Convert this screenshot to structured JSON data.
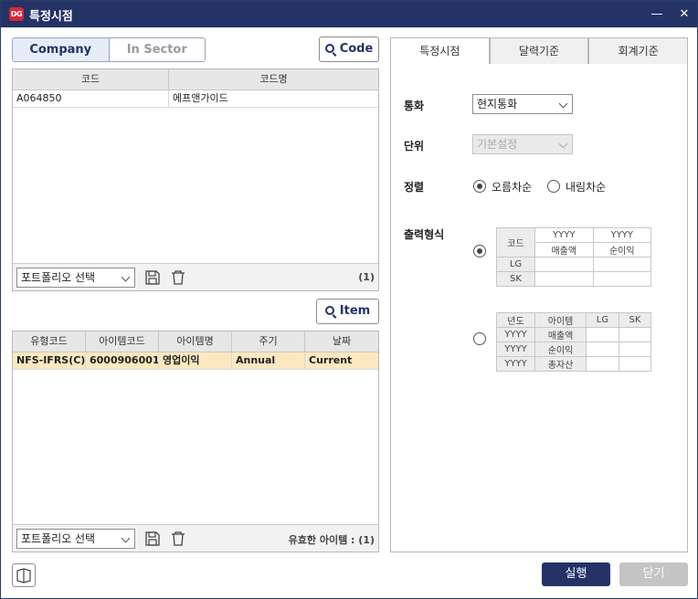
{
  "window": {
    "title": "특정시점",
    "icon_label": "DG"
  },
  "seg": {
    "company": "Company",
    "sector": "In Sector"
  },
  "buttons": {
    "code": "Code",
    "item": "Item",
    "run": "실행",
    "close": "닫기"
  },
  "company_grid": {
    "headers": [
      "코드",
      "코드명"
    ],
    "rows": [
      [
        "A064850",
        "에프앤가이드"
      ]
    ],
    "portfolio": "포트폴리오 선택",
    "count": "(1)"
  },
  "item_grid": {
    "headers": [
      "유형코드",
      "아이템코드",
      "아이템명",
      "주기",
      "날짜"
    ],
    "rows": [
      [
        "NFS-IFRS(C)",
        "6000906001",
        "영업이익",
        "Annual",
        "Current"
      ]
    ],
    "portfolio": "포트폴리오 선택",
    "valid": "유효한 아이템 : (1)"
  },
  "tabs": [
    "특정시점",
    "달력기준",
    "회계기준"
  ],
  "settings": {
    "currency_label": "통화",
    "currency_value": "현지통화",
    "unit_label": "단위",
    "unit_value": "기본설정",
    "sort_label": "정렬",
    "sort_asc": "오름차순",
    "sort_desc": "내림차순",
    "format_label": "출력형식"
  },
  "format1": {
    "code": "코드",
    "yyyy": "YYYY",
    "sales": "매출액",
    "net": "순이익",
    "lg": "LG",
    "sk": "SK"
  },
  "format2": {
    "year": "년도",
    "item": "아이템",
    "lg": "LG",
    "sk": "SK",
    "yyyy": "YYYY",
    "sales": "매출액",
    "net": "순이익",
    "assets": "총자산"
  }
}
